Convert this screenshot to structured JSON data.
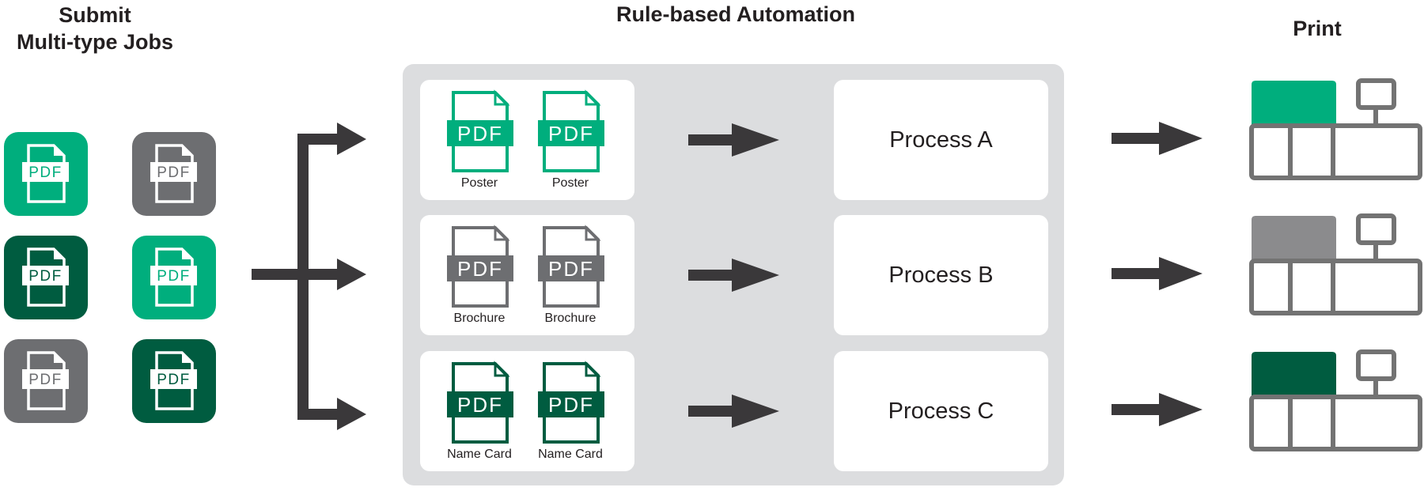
{
  "headings": {
    "submit": "Submit\nMulti-type Jobs",
    "submit_line1": "Submit",
    "submit_line2": "Multi-type Jobs",
    "automation": "Rule-based Automation",
    "print": "Print"
  },
  "colors": {
    "green": "#00ae7d",
    "dark_green": "#005c40",
    "gray": "#6d6e71",
    "arrow": "#3a383a",
    "panel": "#dcdddf",
    "printer_gray": "#737373",
    "printer_mid_gray": "#8b8b8d"
  },
  "source_jobs": [
    {
      "label": "PDF",
      "color": "green"
    },
    {
      "label": "PDF",
      "color": "gray"
    },
    {
      "label": "PDF",
      "color": "dark_green"
    },
    {
      "label": "PDF",
      "color": "green"
    },
    {
      "label": "PDF",
      "color": "gray"
    },
    {
      "label": "PDF",
      "color": "dark_green"
    }
  ],
  "rows": [
    {
      "files": [
        {
          "badge": "PDF",
          "label": "Poster"
        },
        {
          "badge": "PDF",
          "label": "Poster"
        }
      ],
      "color": "green",
      "process": "Process A",
      "printer_color": "green"
    },
    {
      "files": [
        {
          "badge": "PDF",
          "label": "Brochure"
        },
        {
          "badge": "PDF",
          "label": "Brochure"
        }
      ],
      "color": "gray",
      "process": "Process B",
      "printer_color": "gray"
    },
    {
      "files": [
        {
          "badge": "PDF",
          "label": "Name Card"
        },
        {
          "badge": "PDF",
          "label": "Name Card"
        }
      ],
      "color": "dark_green",
      "process": "Process C",
      "printer_color": "dark_green"
    }
  ]
}
